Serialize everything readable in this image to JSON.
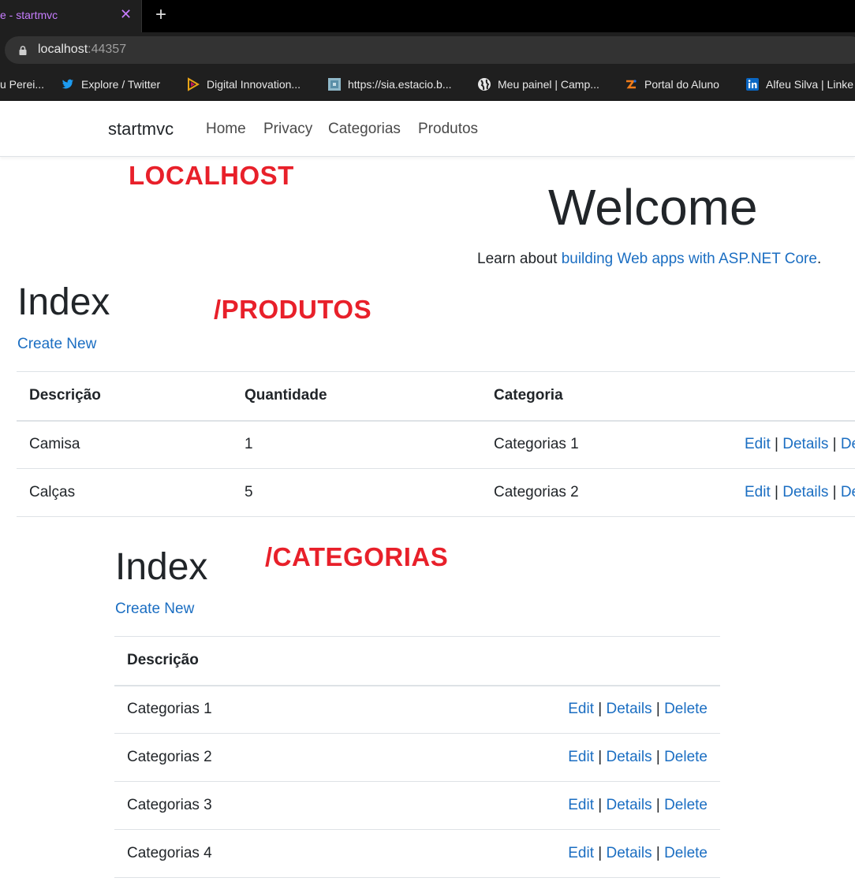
{
  "browser": {
    "tab_title": "e - startmvc",
    "tab_close": "✕",
    "new_tab": "+",
    "url_host": "localhost",
    "url_port": ":44357",
    "bookmarks": [
      {
        "label": "u Perei...",
        "icon": "none"
      },
      {
        "label": "Explore / Twitter",
        "icon": "twitter-icon",
        "color": "#1d9bf0"
      },
      {
        "label": "Digital Innovation...",
        "icon": "dio-icon",
        "color": "#e8a317"
      },
      {
        "label": "https://sia.estacio.b...",
        "icon": "sia-icon",
        "color": "#6ab0c8"
      },
      {
        "label": "Meu painel | Camp...",
        "icon": "globe-icon",
        "color": "#e8e8e8"
      },
      {
        "label": "Portal do Aluno",
        "icon": "portal-icon",
        "color": "#f07c1a"
      },
      {
        "label": "Alfeu Silva | Linke",
        "icon": "linkedin-icon",
        "color": "#0a66c2"
      }
    ]
  },
  "nav": {
    "brand": "startmvc",
    "links": [
      "Home",
      "Privacy",
      "Categorias",
      "Produtos"
    ]
  },
  "annotations": {
    "localhost": "LOCALHOST",
    "produtos": "/PRODUTOS",
    "categorias": "/CATEGORIAS"
  },
  "welcome": {
    "title": "Welcome",
    "learn_prefix": "Learn about ",
    "learn_link": "building Web apps with ASP.NET Core",
    "learn_suffix": "."
  },
  "produtos": {
    "heading": "Index",
    "create_new": "Create New",
    "columns": [
      "Descrição",
      "Quantidade",
      "Categoria"
    ],
    "rows": [
      {
        "descricao": "Camisa",
        "quantidade": "1",
        "categoria": "Categorias 1"
      },
      {
        "descricao": "Calças",
        "quantidade": "5",
        "categoria": "Categorias 2"
      }
    ],
    "actions": {
      "edit": "Edit",
      "details": "Details",
      "delete": "De",
      "sep": "|"
    }
  },
  "categorias": {
    "heading": "Index",
    "create_new": "Create New",
    "columns": [
      "Descrição"
    ],
    "rows": [
      {
        "descricao": "Categorias 1"
      },
      {
        "descricao": "Categorias 2"
      },
      {
        "descricao": "Categorias 3"
      },
      {
        "descricao": "Categorias 4"
      }
    ],
    "actions": {
      "edit": "Edit",
      "details": "Details",
      "delete": "Delete",
      "sep": "|"
    }
  },
  "colors": {
    "link": "#1b6ec2",
    "annotation": "#e8202a"
  }
}
